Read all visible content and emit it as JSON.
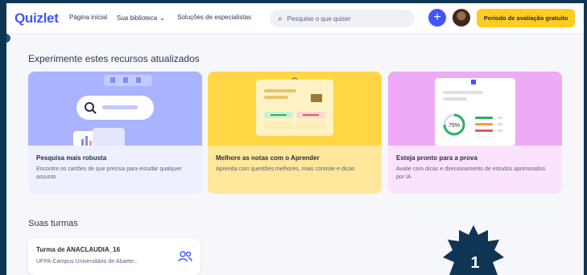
{
  "topbar": {
    "logo": "Quizlet",
    "nav": [
      "Página inicial",
      "Sua biblioteca",
      "Soluções de especialistas"
    ],
    "search_placeholder": "Pesquise o que quiser",
    "trial_button": "Período de avaliação gratuito"
  },
  "features": {
    "title": "Experimente estes recursos atualizados",
    "cards": [
      {
        "title": "Pesquisa mais robusta",
        "description": "Encontre os cartões de que precisa para estudar qualquer assunto"
      },
      {
        "title": "Melhore as notas com o Aprender",
        "description": "Aprenda com questões melhores, mais controle e dicas"
      },
      {
        "title": "Esteja pronto para a prova",
        "description": "Avalie com dicas e direcionamento de estudos aprimorados por IA"
      }
    ],
    "progress_label": "75%"
  },
  "classes": {
    "title": "Suas turmas",
    "items": [
      {
        "name": "Turma de ANACLAUDIA_16",
        "school": "UFPA-Campus Universitário de Abaete..."
      }
    ]
  },
  "step_badge": "1",
  "colors": {
    "brand": "#4255ff",
    "trial": "#ffcd1f",
    "card_blue": "#a9b3ff",
    "card_yellow": "#ffd745",
    "card_pink": "#eeaaf5"
  }
}
